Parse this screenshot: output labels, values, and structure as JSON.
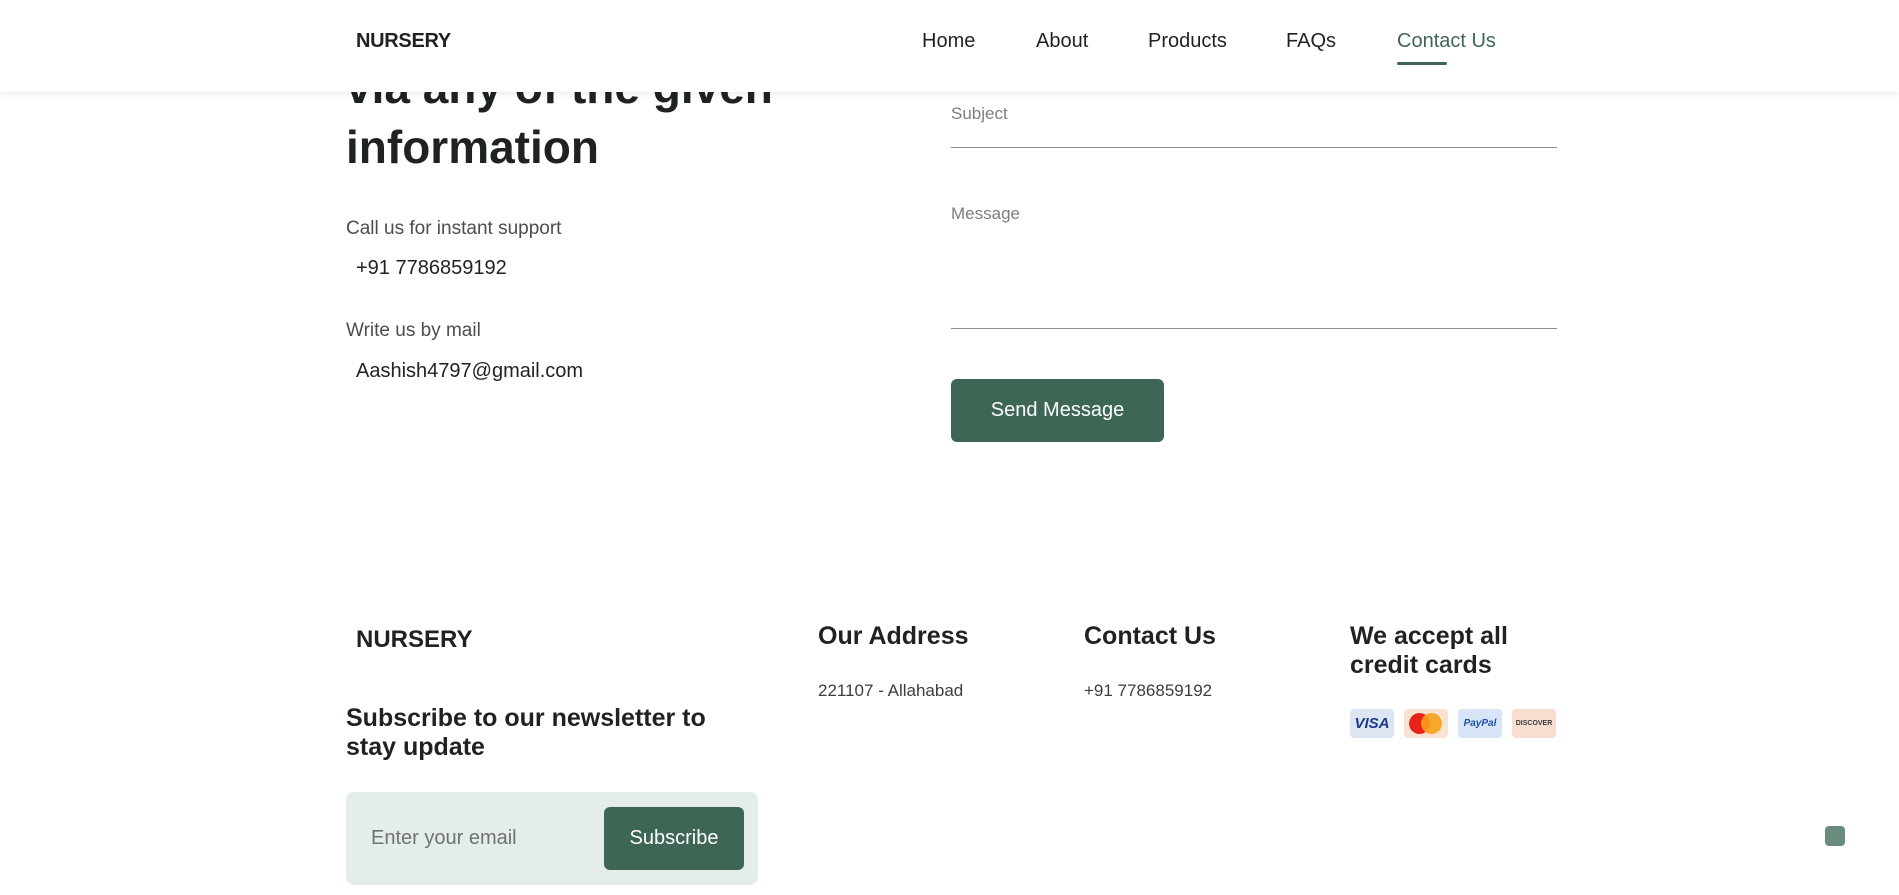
{
  "nav": {
    "brand": "NURSERY",
    "links": [
      "Home",
      "About",
      "Products",
      "FAQs",
      "Contact Us"
    ],
    "active": "Contact Us"
  },
  "contact_section": {
    "heading_partial": "via any of the given",
    "heading_line2": "information",
    "call_label": "Call us for instant support",
    "phone": "+91 7786859192",
    "mail_label": "Write us by mail",
    "email": "Aashish4797@gmail.com",
    "form": {
      "subject_label": "Subject",
      "message_label": "Message",
      "send_label": "Send Message"
    }
  },
  "footer": {
    "brand": "NURSERY",
    "newsletter_title": "Subscribe to our newsletter to stay update",
    "email_placeholder": "Enter your email",
    "subscribe_label": "Subscribe",
    "address_title": "Our Address",
    "address_text": "221107 - Allahabad",
    "contact_title": "Contact Us",
    "contact_text": "+91 7786859192",
    "cards_title": "We accept all credit cards",
    "cards": {
      "visa": "VISA",
      "mastercard": "mastercard-icon",
      "paypal": "PayPal",
      "discover": "DISCOVER"
    }
  },
  "colors": {
    "accent": "#3d6654",
    "subscribe_bg": "#e5ede9"
  }
}
